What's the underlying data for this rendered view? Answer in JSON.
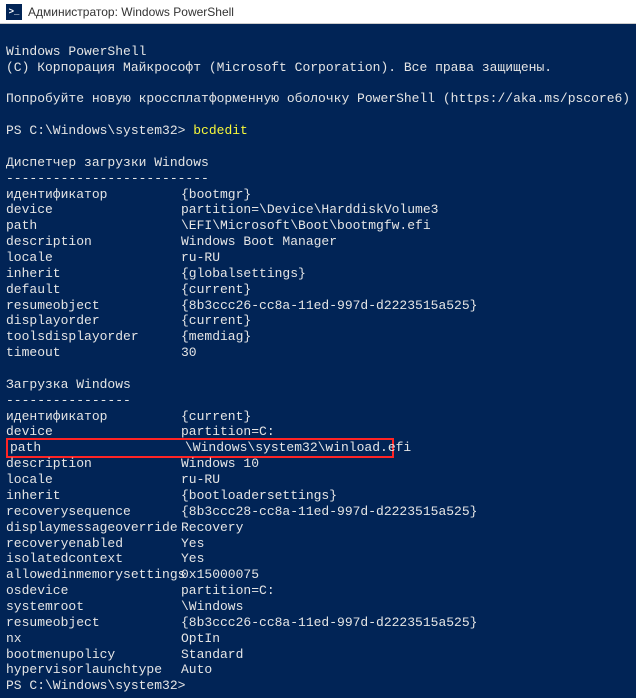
{
  "window": {
    "title": "Администратор: Windows PowerShell",
    "icon_label": ">_"
  },
  "header": {
    "line1": "Windows PowerShell",
    "line2": "(C) Корпорация Майкрософт (Microsoft Corporation). Все права защищены.",
    "line3": "Попробуйте новую кроссплатформенную оболочку PowerShell (https://aka.ms/pscore6)"
  },
  "prompt1": {
    "prefix": "PS C:\\Windows\\system32> ",
    "command": "bcdedit"
  },
  "section1": {
    "title": "Диспетчер загрузки Windows",
    "divider": "--------------------------",
    "rows": [
      {
        "k": "идентификатор",
        "v": "{bootmgr}"
      },
      {
        "k": "device",
        "v": "partition=\\Device\\HarddiskVolume3"
      },
      {
        "k": "path",
        "v": "\\EFI\\Microsoft\\Boot\\bootmgfw.efi"
      },
      {
        "k": "description",
        "v": "Windows Boot Manager"
      },
      {
        "k": "locale",
        "v": "ru-RU"
      },
      {
        "k": "inherit",
        "v": "{globalsettings}"
      },
      {
        "k": "default",
        "v": "{current}"
      },
      {
        "k": "resumeobject",
        "v": "{8b3ccc26-cc8a-11ed-997d-d2223515a525}"
      },
      {
        "k": "displayorder",
        "v": "{current}"
      },
      {
        "k": "toolsdisplayorder",
        "v": "{memdiag}"
      },
      {
        "k": "timeout",
        "v": "30"
      }
    ]
  },
  "section2": {
    "title": "Загрузка Windows",
    "divider": "----------------",
    "rows_before": [
      {
        "k": "идентификатор",
        "v": "{current}"
      },
      {
        "k": "device",
        "v": "partition=C:"
      }
    ],
    "highlighted": {
      "k": "path",
      "v": "\\Windows\\system32\\winload.efi"
    },
    "rows_after": [
      {
        "k": "description",
        "v": "Windows 10"
      },
      {
        "k": "locale",
        "v": "ru-RU"
      },
      {
        "k": "inherit",
        "v": "{bootloadersettings}"
      },
      {
        "k": "recoverysequence",
        "v": "{8b3ccc28-cc8a-11ed-997d-d2223515a525}"
      },
      {
        "k": "displaymessageoverride",
        "v": "Recovery"
      },
      {
        "k": "recoveryenabled",
        "v": "Yes"
      },
      {
        "k": "isolatedcontext",
        "v": "Yes"
      },
      {
        "k": "allowedinmemorysettings",
        "v": "0x15000075"
      },
      {
        "k": "osdevice",
        "v": "partition=C:"
      },
      {
        "k": "systemroot",
        "v": "\\Windows"
      },
      {
        "k": "resumeobject",
        "v": "{8b3ccc26-cc8a-11ed-997d-d2223515a525}"
      },
      {
        "k": "nx",
        "v": "OptIn"
      },
      {
        "k": "bootmenupolicy",
        "v": "Standard"
      },
      {
        "k": "hypervisorlaunchtype",
        "v": "Auto"
      }
    ]
  },
  "prompt2": "PS C:\\Windows\\system32>"
}
